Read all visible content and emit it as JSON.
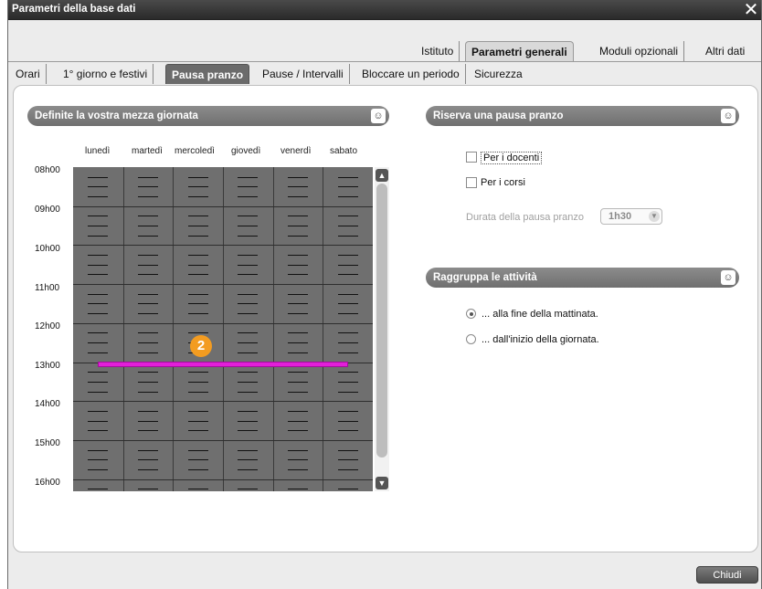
{
  "window": {
    "title": "Parametri della base dati",
    "close_glyph": "✕"
  },
  "top_tabs": [
    {
      "label": "Istituto"
    },
    {
      "label": "Parametri generali"
    },
    {
      "label": "Moduli opzionali"
    },
    {
      "label": "Altri dati"
    }
  ],
  "sub_tabs": [
    {
      "label": "Orari"
    },
    {
      "label": "1° giorno e festivi"
    },
    {
      "label": "Pausa pranzo"
    },
    {
      "label": "Pause / Intervalli"
    },
    {
      "label": "Bloccare un periodo"
    },
    {
      "label": "Sicurezza"
    }
  ],
  "left_section": {
    "title": "Definite la vostra mezza giornata",
    "days": [
      "lunedì",
      "martedì",
      "mercoledì",
      "giovedì",
      "venerdì",
      "sabato"
    ],
    "hours": [
      "08h00",
      "09h00",
      "10h00",
      "11h00",
      "12h00",
      "13h00",
      "14h00",
      "15h00",
      "16h00"
    ],
    "marker_number": "2"
  },
  "reserve_section": {
    "title": "Riserva una pausa pranzo",
    "options": [
      {
        "label": "Per i docenti",
        "checked": false
      },
      {
        "label": "Per i corsi",
        "checked": false
      }
    ],
    "duration_label": "Durata della pausa pranzo",
    "duration_value": "1h30"
  },
  "group_section": {
    "title": "Raggruppa le attività",
    "options": [
      {
        "label": "... alla fine della mattinata.",
        "selected": true
      },
      {
        "label": "... dall'inizio della giornata.",
        "selected": false
      }
    ]
  },
  "footer": {
    "close_label": "Chiudi"
  },
  "colors": {
    "pause_bar": "#e21fd9",
    "marker": "#f39c21",
    "grid": "#6f6f6f"
  },
  "icons": [
    "close-icon",
    "section-menu-icon",
    "scroll-up-icon",
    "scroll-down-icon",
    "dropdown-arrow-icon"
  ]
}
